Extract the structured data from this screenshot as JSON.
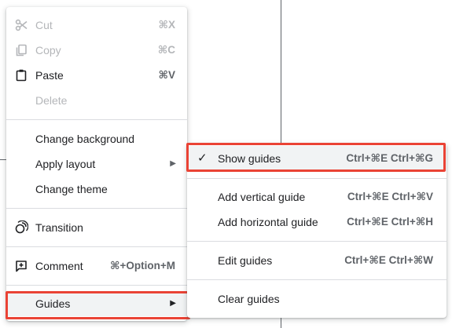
{
  "main_menu": {
    "cut": {
      "label": "Cut",
      "shortcut": "⌘X",
      "icon": "scissors-icon"
    },
    "copy": {
      "label": "Copy",
      "shortcut": "⌘C",
      "icon": "copy-icon"
    },
    "paste": {
      "label": "Paste",
      "shortcut": "⌘V",
      "icon": "clipboard-icon"
    },
    "delete": {
      "label": "Delete"
    },
    "change_background": {
      "label": "Change background"
    },
    "apply_layout": {
      "label": "Apply layout",
      "arrow": "▶"
    },
    "change_theme": {
      "label": "Change theme"
    },
    "transition": {
      "label": "Transition",
      "icon": "transition-icon"
    },
    "comment": {
      "label": "Comment",
      "shortcut": "⌘+Option+M",
      "icon": "add-comment-icon"
    },
    "guides": {
      "label": "Guides",
      "arrow": "▶"
    }
  },
  "guides_submenu": {
    "show_guides": {
      "label": "Show guides",
      "shortcut": "Ctrl+⌘E Ctrl+⌘G",
      "checked": true,
      "check": "✓"
    },
    "add_vertical_guide": {
      "label": "Add vertical guide",
      "shortcut": "Ctrl+⌘E Ctrl+⌘V"
    },
    "add_horizontal_guide": {
      "label": "Add horizontal guide",
      "shortcut": "Ctrl+⌘E Ctrl+⌘H"
    },
    "edit_guides": {
      "label": "Edit guides",
      "shortcut": "Ctrl+⌘E Ctrl+⌘W"
    },
    "clear_guides": {
      "label": "Clear guides"
    }
  },
  "colors": {
    "highlight_outline": "#ea4335",
    "hover_bg": "#f1f3f4",
    "disabled_text": "#b4b6b9"
  }
}
